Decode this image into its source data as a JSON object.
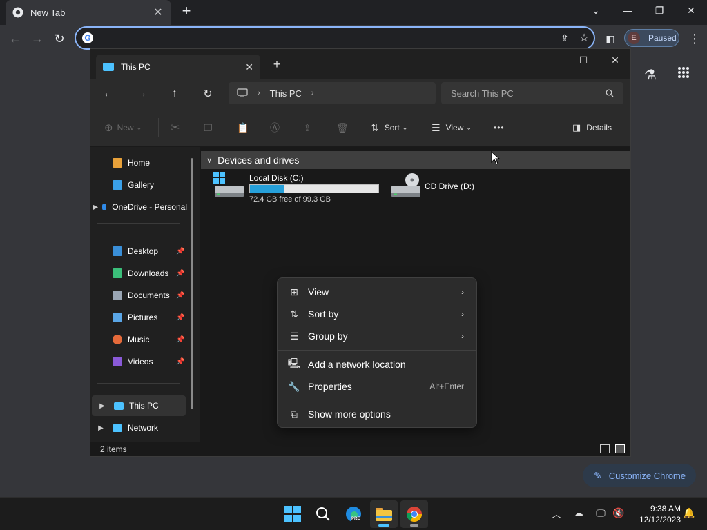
{
  "chrome": {
    "tab_title": "New Tab",
    "tab_close": "✕",
    "new_tab": "+",
    "window_controls": {
      "minimize": "—",
      "restore": "❐",
      "close": "✕",
      "tab_search": "⌄"
    },
    "omnibox": {
      "value": "",
      "icon": "G"
    },
    "profile": {
      "initial": "E",
      "status": "Paused"
    },
    "customize_label": "Customize Chrome"
  },
  "explorer": {
    "tab_title": "This PC",
    "tab_close": "✕",
    "new_tab": "+",
    "window_controls": {
      "minimize": "—",
      "maximize": "☐",
      "close": "✕"
    },
    "breadcrumb": {
      "location": "This PC",
      "sep1": "›",
      "sep2": "›"
    },
    "search_placeholder": "Search This PC",
    "commands": {
      "new": "New",
      "sort": "Sort",
      "view": "View",
      "more": "•••",
      "details": "Details"
    },
    "nav_pane": {
      "items": [
        {
          "label": "Home",
          "color": "#e8a13a"
        },
        {
          "label": "Gallery",
          "color": "#3aa0e8"
        },
        {
          "label": "OneDrive - Personal",
          "color": "#2f8ae8"
        },
        {
          "label": "Desktop",
          "color": "#3a8fd8"
        },
        {
          "label": "Downloads",
          "color": "#3bbf7a"
        },
        {
          "label": "Documents",
          "color": "#9aa6b4"
        },
        {
          "label": "Pictures",
          "color": "#5aa6e6"
        },
        {
          "label": "Music",
          "color": "#e56a3a"
        },
        {
          "label": "Videos",
          "color": "#8a5ad8"
        },
        {
          "label": "This PC",
          "color": "#4cc2ff"
        },
        {
          "label": "Network",
          "color": "#4cc2ff"
        }
      ]
    },
    "group_header": "Devices and drives",
    "drives": [
      {
        "name": "Local Disk (C:)",
        "free_text": "72.4 GB free of 99.3 GB",
        "used_fraction": 0.271
      },
      {
        "name": "CD Drive (D:)"
      }
    ],
    "status": "2 items",
    "context_menu": {
      "items": [
        {
          "label": "View",
          "icon": "grid-icon"
        },
        {
          "label": "Sort by",
          "icon": "sort-icon"
        },
        {
          "label": "Group by",
          "icon": "group-icon"
        },
        {
          "label": "Add a network location",
          "icon": "network-location-icon"
        },
        {
          "label": "Properties",
          "icon": "wrench-icon",
          "accelerator": "Alt+Enter"
        },
        {
          "label": "Show more options",
          "icon": "external-icon"
        }
      ]
    }
  },
  "taskbar": {
    "time": "9:38 AM",
    "date": "12/12/2023",
    "edge_badge": "PRE"
  },
  "colors": {
    "accent": "#4cc2ff",
    "chrome_focus": "#8ab4f8",
    "disk_bar": "#26a0da"
  }
}
